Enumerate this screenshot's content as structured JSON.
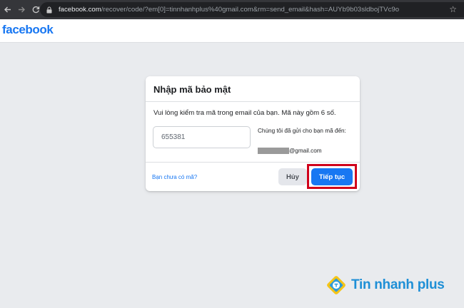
{
  "browser": {
    "url_host": "facebook.com",
    "url_path": "/recover/code/?em[0]=tinnhanhplus%40gmail.com&rm=send_email&hash=AUYb9b03sldbojTVc9o",
    "icons": [
      "back-arrow-icon",
      "forward-arrow-icon",
      "reload-icon",
      "lock-icon",
      "star-icon"
    ]
  },
  "header": {
    "logo": "facebook",
    "brand_color": "#1877f2"
  },
  "dialog": {
    "title": "Nhập mã bảo mật",
    "description": "Vui lòng kiểm tra mã trong email của bạn. Mã này gồm 6 số.",
    "code_value": "655381",
    "sent_info": "Chúng tôi đã gửi cho bạn mã đến:",
    "email_suffix": "@gmail.com",
    "no_code_link": "Bạn chưa có mã?",
    "cancel_label": "Hủy",
    "continue_label": "Tiếp tục",
    "highlight_color": "#d0021b"
  },
  "watermark": {
    "text": "Tin nhanh plus"
  }
}
